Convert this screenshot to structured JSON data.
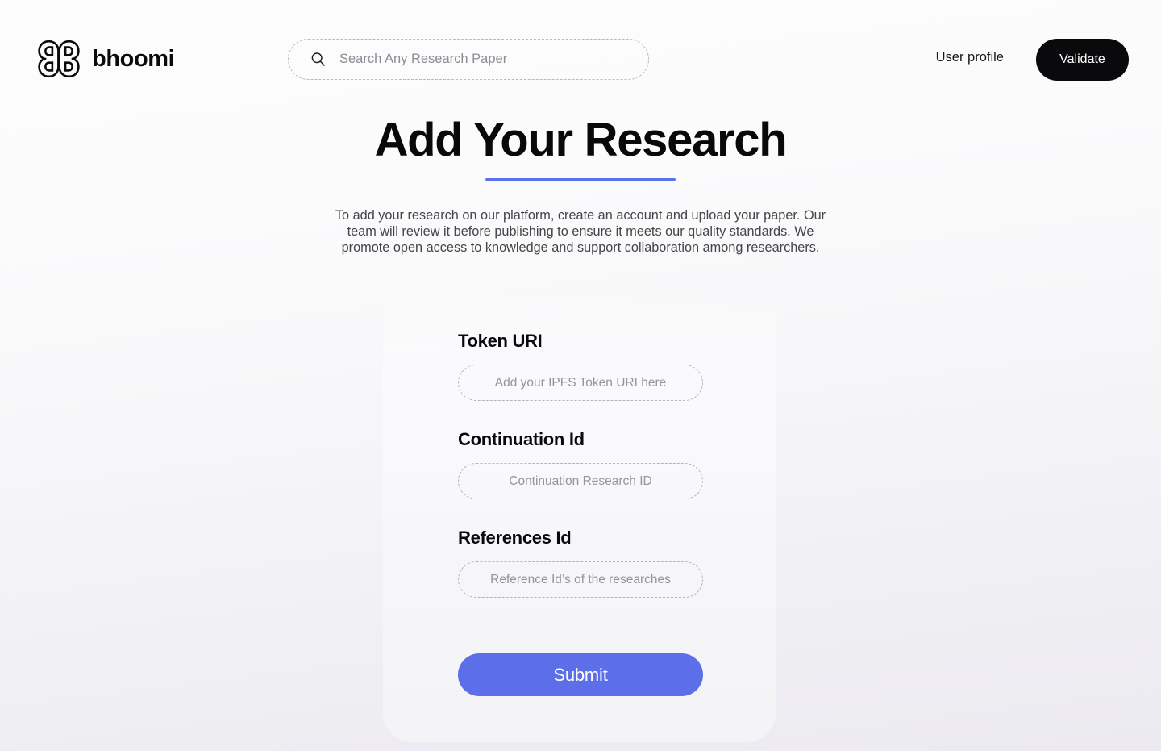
{
  "header": {
    "brand_name": "bhoomi",
    "brand_logo_icon": "bhoomi-double-b-monogram",
    "search": {
      "icon": "search-icon",
      "placeholder": "Search Any Research Paper",
      "value": ""
    },
    "user_profile_label": "User profile",
    "validate_label": "Validate"
  },
  "hero": {
    "title": "Add Your Research",
    "underline_color": "#5a73ea",
    "intro": "To add your research on our platform, create an account and upload your paper. Our team will review it before publishing to ensure it meets our quality standards. We promote open access to knowledge and support collaboration among researchers."
  },
  "form": {
    "fields": [
      {
        "label": "Token URI",
        "placeholder": "Add your IPFS Token URI here",
        "value": ""
      },
      {
        "label": "Continuation Id",
        "placeholder": "Continuation Research ID",
        "value": ""
      },
      {
        "label": "References Id",
        "placeholder": "Reference Id’s of the researches",
        "value": ""
      }
    ],
    "submit_label": "Submit",
    "submit_color": "#5c6fe8"
  },
  "colors": {
    "accent_blue": "#5c6fe8",
    "underline_blue": "#5a73ea",
    "dark": "#0a0a0c",
    "page_bg_top": "#fcfcfd",
    "page_bg_bottom": "#eceaf0"
  }
}
